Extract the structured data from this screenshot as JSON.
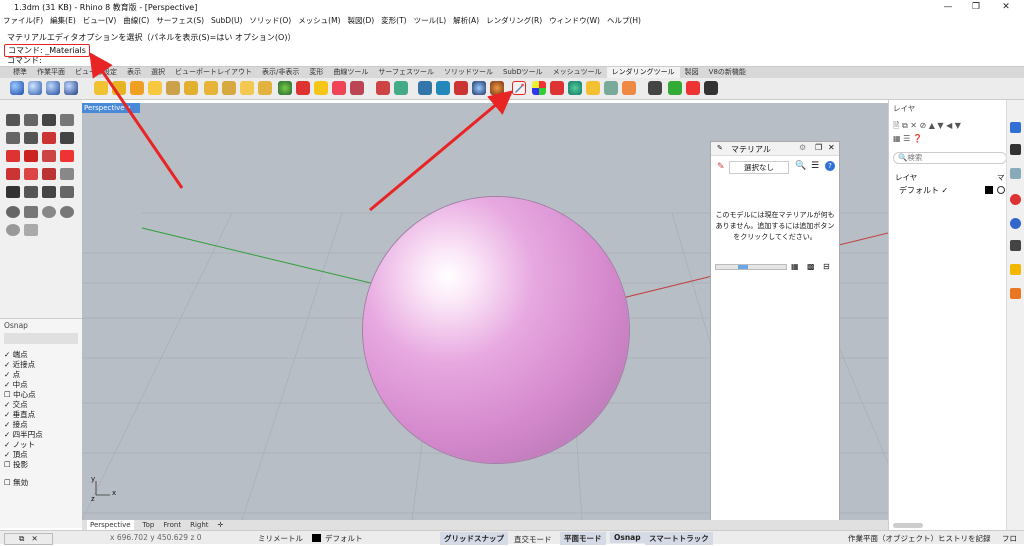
{
  "window": {
    "title": "1.3dm (31 KB) - Rhino 8 教育版 - [Perspective]"
  },
  "menu": [
    "ファイル(F)",
    "編集(E)",
    "ビュー(V)",
    "曲線(C)",
    "サーフェス(S)",
    "SubD(U)",
    "ソリッド(O)",
    "メッシュ(M)",
    "製図(D)",
    "変形(T)",
    "ツール(L)",
    "解析(A)",
    "レンダリング(R)",
    "ウィンドウ(W)",
    "ヘルプ(H)"
  ],
  "command": {
    "history": "マテリアルエディタオプションを選択（パネルを表示(S)=はい  オプション(O)）",
    "last": "コマンド: _Materials",
    "prompt": "コマンド:"
  },
  "toolbar_tabs": [
    "標準",
    "作業平面",
    "ビューの設定",
    "表示",
    "選択",
    "ビューポートレイアウト",
    "表示/非表示",
    "変形",
    "曲線ツール",
    "サーフェスツール",
    "ソリッドツール",
    "SubDツール",
    "メッシュツール",
    "レンダリングツール",
    "製図",
    "V8の新機能"
  ],
  "active_tab": "レンダリングツール",
  "viewport": {
    "label": "Perspective",
    "axis_x": "x",
    "axis_y": "y",
    "axis_z": "z"
  },
  "viewport_tabs": [
    "Perspective",
    "Top",
    "Front",
    "Right"
  ],
  "osnap": {
    "title": "Osnap",
    "items": [
      {
        "label": "端点",
        "checked": true
      },
      {
        "label": "近接点",
        "checked": true
      },
      {
        "label": "点",
        "checked": true
      },
      {
        "label": "中点",
        "checked": true
      },
      {
        "label": "中心点",
        "checked": false
      },
      {
        "label": "交点",
        "checked": true
      },
      {
        "label": "垂直点",
        "checked": true
      },
      {
        "label": "接点",
        "checked": true
      },
      {
        "label": "四半円点",
        "checked": true
      },
      {
        "label": "ノット",
        "checked": true
      },
      {
        "label": "頂点",
        "checked": true
      },
      {
        "label": "投影",
        "checked": false
      },
      {
        "label": "無効",
        "checked": false
      }
    ]
  },
  "materials_panel": {
    "title": "マテリアル",
    "filter": "選択なし",
    "message": "このモデルには現在マテリアルが何もありません。追加するには追加ボタンをクリックしてください。"
  },
  "layers_panel": {
    "title": "レイヤ",
    "search_placeholder": "検索",
    "col_layer": "レイヤ",
    "col_mat": "マ",
    "rows": [
      {
        "name": "デフォルト",
        "current": "✓"
      }
    ]
  },
  "status": {
    "coords": "x 696.702   y 450.629   z 0",
    "units": "ミリメートル",
    "layer": "デフォルト",
    "buttons": [
      "グリッドスナップ",
      "直交モード",
      "平面モード",
      "Osnap",
      "スマートトラック"
    ],
    "cplane": "作業平面（オブジェクト）",
    "history": "ヒストリを記録",
    "filter": "フロ"
  },
  "colors": {
    "accent": "#4a89d8",
    "sphere": "#d99fd3",
    "arrow": "#e82424",
    "x_axis": "#c24040",
    "y_axis": "#2e9e3a"
  }
}
